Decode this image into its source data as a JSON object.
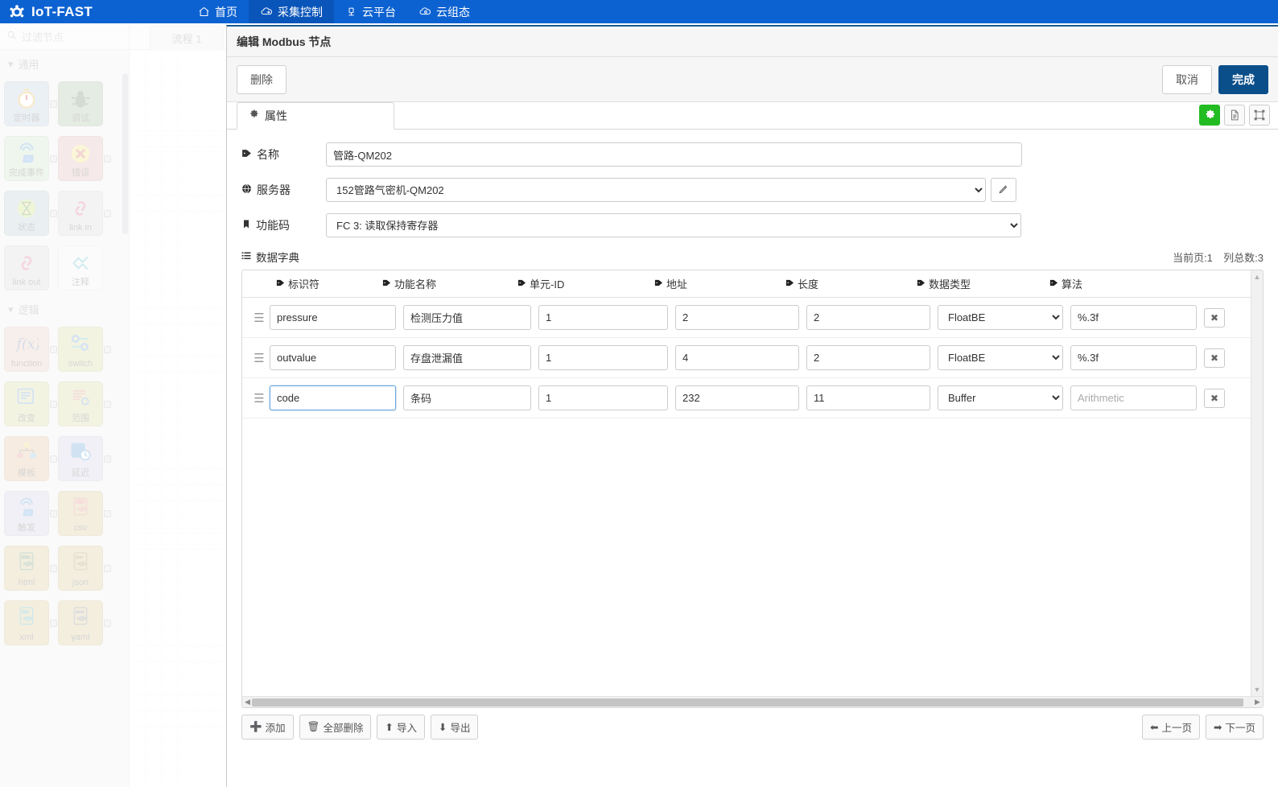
{
  "nav": {
    "brand": "IoT-FAST",
    "items": [
      {
        "label": "首页",
        "icon": "home-icon",
        "active": false
      },
      {
        "label": "采集控制",
        "icon": "cloud-collect-icon",
        "active": true
      },
      {
        "label": "云平台",
        "icon": "cloud-platform-icon",
        "active": false
      },
      {
        "label": "云组态",
        "icon": "cloud-config-icon",
        "active": false
      }
    ]
  },
  "editor": {
    "search_placeholder": "过滤节点",
    "flow_tab": "流程 1",
    "categories": [
      {
        "label": "通用"
      },
      {
        "label": "逻辑"
      }
    ],
    "nodes": [
      {
        "label": "定时器",
        "icon": "timer-icon",
        "bg": "#a6bcd0"
      },
      {
        "label": "调试",
        "icon": "bug-icon",
        "bg": "#87a980"
      },
      {
        "label": "完成事件",
        "icon": "touch-event-icon",
        "bg": "#b8d4af"
      },
      {
        "label": "错误",
        "icon": "error-icon",
        "bg": "#d79a9a"
      },
      {
        "label": "状态",
        "icon": "hourglass-icon",
        "bg": "#9fb6c4"
      },
      {
        "label": "link in",
        "icon": "link-in-icon",
        "bg": "#c9c9c9"
      },
      {
        "label": "link out",
        "icon": "link-out-icon",
        "bg": "#c9c9c9"
      },
      {
        "label": "注释",
        "icon": "comment-icon",
        "bg": "#e9e9e9"
      },
      {
        "label": "function",
        "icon": "function-icon",
        "bg": "#dcb8a6"
      },
      {
        "label": "switch",
        "icon": "switch-icon",
        "bg": "#c9c87a"
      },
      {
        "label": "改变",
        "icon": "change-icon",
        "bg": "#c9c87a"
      },
      {
        "label": "范围",
        "icon": "range-icon",
        "bg": "#c9c87a"
      },
      {
        "label": "模板",
        "icon": "template-icon",
        "bg": "#d8a878"
      },
      {
        "label": "延迟",
        "icon": "delay-icon",
        "bg": "#c0bcd6"
      },
      {
        "label": "触发",
        "icon": "trigger-icon",
        "bg": "#c0bcd6"
      },
      {
        "label": "csv",
        "icon": "csv-icon",
        "bg": "#c9b06a"
      },
      {
        "label": "html",
        "icon": "html-icon",
        "bg": "#c9b06a"
      },
      {
        "label": "json",
        "icon": "json-icon",
        "bg": "#c9b06a"
      },
      {
        "label": "xml",
        "icon": "xml-icon",
        "bg": "#c9b06a"
      },
      {
        "label": "yaml",
        "icon": "yaml-icon",
        "bg": "#c9b06a"
      }
    ]
  },
  "dialog": {
    "title": "编辑 Modbus 节点",
    "delete_label": "删除",
    "cancel_label": "取消",
    "done_label": "完成",
    "tab_label": "属性",
    "actions": [
      {
        "name": "settings-gear-icon",
        "label": ""
      },
      {
        "name": "document-icon",
        "label": ""
      },
      {
        "name": "fit-frame-icon",
        "label": ""
      }
    ],
    "form": {
      "name_label": "名称",
      "name_value": "管路-QM202",
      "server_label": "服务器",
      "server_value": "152管路气密机-QM202",
      "edit_server_icon": "pencil-icon",
      "funccode_label": "功能码",
      "funccode_value": "FC 3: 读取保持寄存器"
    },
    "dict": {
      "title": "数据字典",
      "current_page_text": "当前页:1",
      "total_cols_text": "列总数:3",
      "columns": [
        "标识符",
        "功能名称",
        "单元-ID",
        "地址",
        "长度",
        "数据类型",
        "算法"
      ],
      "rows": [
        {
          "id": "pressure",
          "func_name": "检测压力值",
          "unit_id": "1",
          "address": "2",
          "length": "2",
          "data_type": "FloatBE",
          "algorithm": "%.3f",
          "algorithm_placeholder": "Arithmetic",
          "focused": false
        },
        {
          "id": "outvalue",
          "func_name": "存盘泄漏值",
          "unit_id": "1",
          "address": "4",
          "length": "2",
          "data_type": "FloatBE",
          "algorithm": "%.3f",
          "algorithm_placeholder": "Arithmetic",
          "focused": false
        },
        {
          "id": "code",
          "func_name": "条码",
          "unit_id": "1",
          "address": "232",
          "length": "11",
          "data_type": "Buffer",
          "algorithm": "",
          "algorithm_placeholder": "Arithmetic",
          "focused": true
        }
      ],
      "delete_row_icon": "close-icon",
      "footer": {
        "add_label": "添加",
        "delete_all_label": "全部删除",
        "import_label": "导入",
        "export_label": "导出",
        "prev_page_label": "上一页",
        "next_page_label": "下一页"
      }
    }
  },
  "colors": {
    "nav_bg": "#0d62d1",
    "nav_active_bg": "#0a55ba",
    "primary_btn": "#0b4f8a",
    "green_btn": "#22bb22",
    "focus_border": "#6aa6de"
  }
}
